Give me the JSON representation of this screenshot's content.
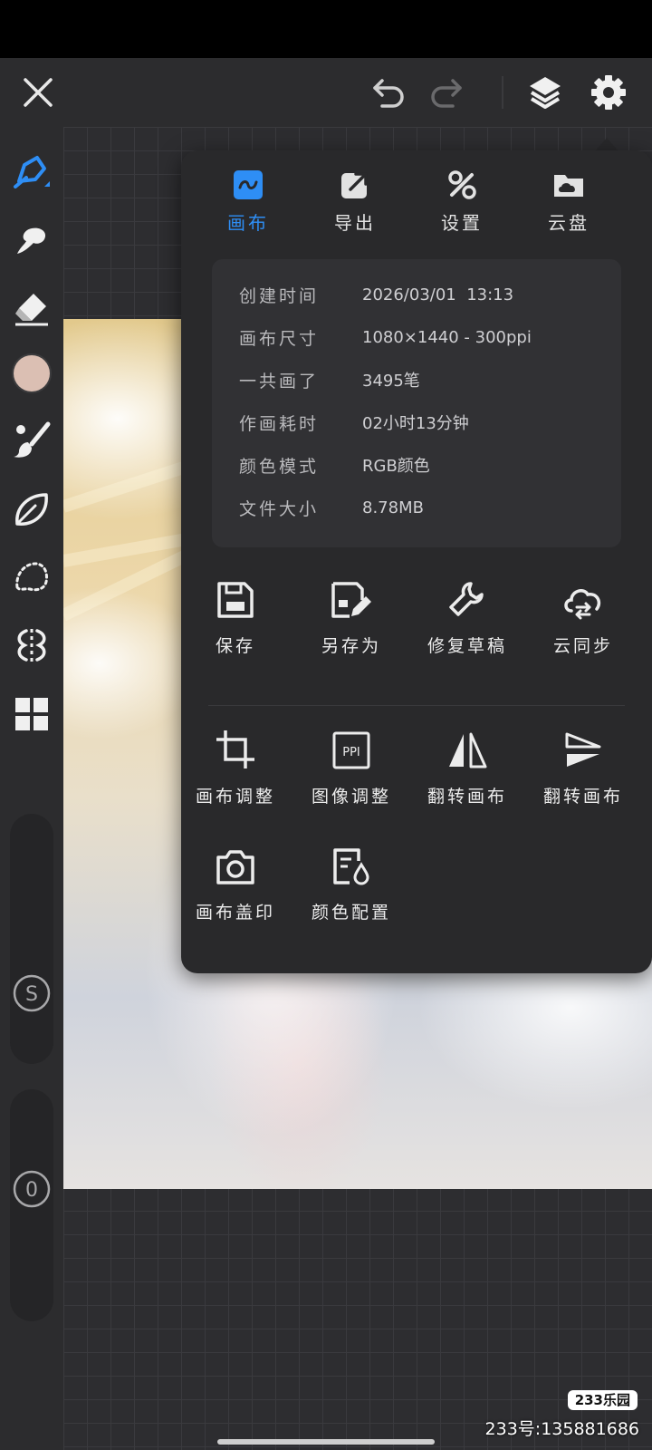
{
  "toolbar": {
    "close_icon": "close-icon",
    "undo_icon": "undo-icon",
    "redo_icon": "redo-icon",
    "layers_icon": "layers-icon",
    "settings_icon": "gear-icon"
  },
  "sidebar": {
    "tools": [
      "pen-brush-icon",
      "smudge-icon",
      "eraser-icon",
      "color-swatch",
      "paint-brush-icon",
      "leaf-icon",
      "lasso-icon",
      "symmetry-icon",
      "grid-widget-icon"
    ],
    "current_color": "#dbbfb3",
    "size_slider_label": "S",
    "opacity_slider_label": "0"
  },
  "panel": {
    "tabs": [
      {
        "label": "画布",
        "icon": "canvas-icon",
        "active": true
      },
      {
        "label": "导出",
        "icon": "export-icon",
        "active": false
      },
      {
        "label": "设置",
        "icon": "tools-icon",
        "active": false
      },
      {
        "label": "云盘",
        "icon": "cloud-folder-icon",
        "active": false
      }
    ],
    "info": [
      {
        "label": "创建时间",
        "value": "2026/03/01  13:13"
      },
      {
        "label": "画布尺寸",
        "value": "1080×1440 - 300ppi"
      },
      {
        "label": "一共画了",
        "value": "3495笔"
      },
      {
        "label": "作画耗时",
        "value": "02小时13分钟"
      },
      {
        "label": "颜色模式",
        "value": "RGB颜色"
      },
      {
        "label": "文件大小",
        "value": "8.78MB"
      }
    ],
    "actions_row1": [
      {
        "label": "保存",
        "icon": "save-icon"
      },
      {
        "label": "另存为",
        "icon": "save-as-icon"
      },
      {
        "label": "修复草稿",
        "icon": "wrench-icon"
      },
      {
        "label": "云同步",
        "icon": "cloud-sync-icon"
      }
    ],
    "actions_row2": [
      {
        "label": "画布调整",
        "icon": "crop-icon"
      },
      {
        "label": "图像调整",
        "icon": "ppi-icon",
        "icon_text": "PPI"
      },
      {
        "label": "翻转画布",
        "icon": "flip-horizontal-icon"
      },
      {
        "label": "翻转画布",
        "icon": "flip-vertical-icon"
      }
    ],
    "actions_row3": [
      {
        "label": "画布盖印",
        "icon": "camera-icon"
      },
      {
        "label": "颜色配置",
        "icon": "color-profile-icon"
      }
    ],
    "accent_color": "#2e8ef5"
  },
  "watermark": {
    "logo": "233乐园",
    "text": "233号:135881686"
  }
}
